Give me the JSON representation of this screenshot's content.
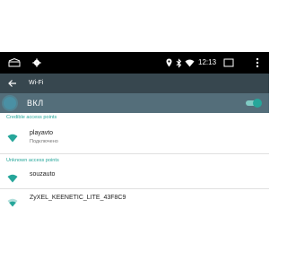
{
  "status_bar": {
    "time": "12:13",
    "icons": [
      "expand-icon",
      "settings-gear-icon",
      "location-icon",
      "bluetooth-icon",
      "wifi-icon",
      "more-vert-icon"
    ]
  },
  "app_bar": {
    "title": "Wi-Fi",
    "back_icon": "back-arrow-icon"
  },
  "switch_bar": {
    "label": "ВКЛ",
    "toggle_on": true
  },
  "sections": {
    "credible_header": "Credible access points",
    "unknown_header": "Unknown access points"
  },
  "networks": {
    "credible": [
      {
        "ssid": "playavto",
        "status": "Подключено"
      }
    ],
    "unknown": [
      {
        "ssid": "souzauto"
      },
      {
        "ssid": "ZyXEL_KEENETIC_LITE_43F8C9"
      }
    ]
  },
  "colors": {
    "statusbar": "#000000",
    "appbar": "#37474f",
    "switchbar": "#546e7a",
    "accent": "#26a69a"
  }
}
